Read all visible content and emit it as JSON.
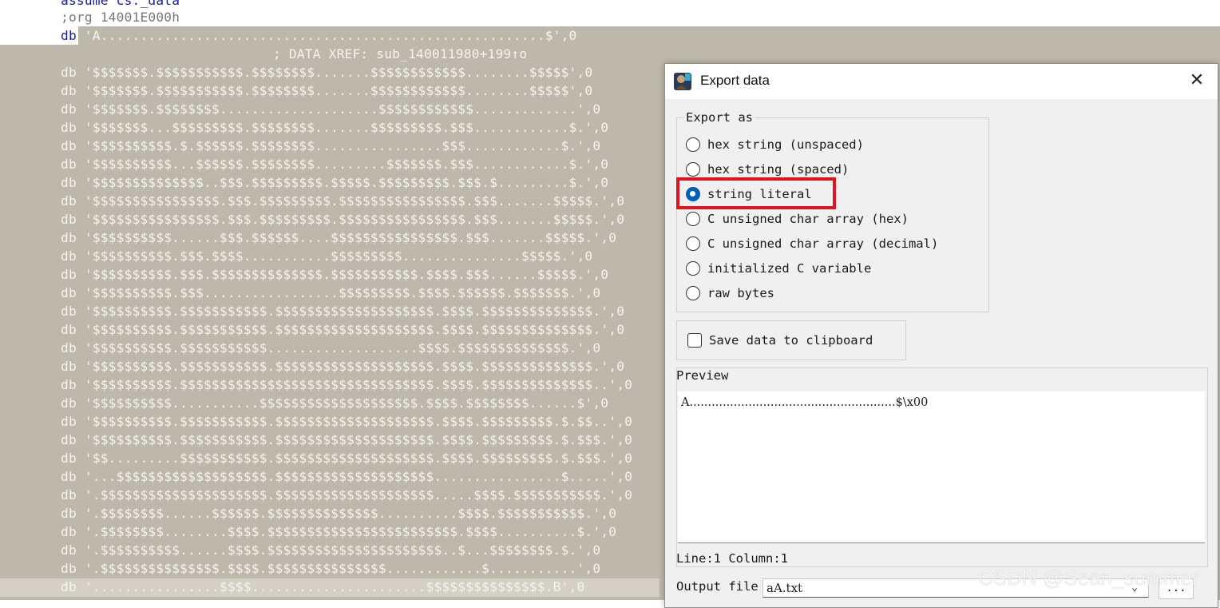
{
  "listing": {
    "header_lines": [
      "assume cs:_data",
      ";org 14001E000h"
    ],
    "first_db_keyword": "db",
    "first_db_value": " 'A........................................................$',0",
    "xref_comment": "; DATA XREF: sub_140011980+199↑o",
    "rows": [
      "db '$$$$$$$.$$$$$$$$$$$.$$$$$$$$.......$$$$$$$$$$$$........$$$$$',0",
      "db '$$$$$$$.$$$$$$$$$$$.$$$$$$$$.......$$$$$$$$$$$$........$$$$$',0",
      "db '$$$$$$$.$$$$$$$$....................$$$$$$$$$$$$.............',0",
      "db '$$$$$$$...$$$$$$$$$.$$$$$$$$.......$$$$$$$$$.$$$............$.',0",
      "db '$$$$$$$$$$.$.$$$$$$.$$$$$$$$................$$$............$.',0",
      "db '$$$$$$$$$$...$$$$$$.$$$$$$$$.........$$$$$$$.$$$............$.',0",
      "db '$$$$$$$$$$$$$$..$$$.$$$$$$$$$.$$$$$.$$$$$$$$$.$$$.$.........$.',0",
      "db '$$$$$$$$$$$$$$$$.$$$.$$$$$$$$$.$$$$$$$$$$$$$$$$.$$$.......$$$$$.',0",
      "db '$$$$$$$$$$$$$$$$.$$$.$$$$$$$$$.$$$$$$$$$$$$$$$$.$$$.......$$$$$.',0",
      "db '$$$$$$$$$$......$$$.$$$$$$....$$$$$$$$$$$$$$$$.$$$.......$$$$$.',0",
      "db '$$$$$$$$$$.$$$.$$$$...........$$$$$$$$$...............$$$$$.',0",
      "db '$$$$$$$$$$.$$$.$$$$$$$$$$$$$$.$$$$$$$$$$$.$$$$.$$$......$$$$$.',0",
      "db '$$$$$$$$$$.$$$.................$$$$$$$$$.$$$$.$$$$$$.$$$$$$$.',0",
      "db '$$$$$$$$$$.$$$$$$$$$$$.$$$$$$$$$$$$$$$$$$$$.$$$$.$$$$$$$$$$$$$$.',0",
      "db '$$$$$$$$$$.$$$$$$$$$$$.$$$$$$$$$$$$$$$$$$$$.$$$$.$$$$$$$$$$$$$$.',0",
      "db '$$$$$$$$$$.$$$$$$$$$$$...................$$$$.$$$$$$$$$$$$$$.',0",
      "db '$$$$$$$$$$.$$$$$$$$$$$.$$$$$$$$$$$$$$$$$$$$.$$$$.$$$$$$$$$$$$$$.',0",
      "db '$$$$$$$$$$.$$$$$$$$$$$$$$$$$$$$$$$$$$$$$$$$.$$$$.$$$$$$$$$$$$$$..',0",
      "db '$$$$$$$$$$...........$$$$$$$$$$$$$$$$$$$$.$$$$.$$$$$$$$......$',0",
      "db '$$$$$$$$$$.$$$$$$$$$$$.$$$$$$$$$$$$$$$$$$$$.$$$$.$$$$$$$$$.$.$$..',0",
      "db '$$$$$$$$$$.$$$$$$$$$$$.$$$$$$$$$$$$$$$$$$$$.$$$$.$$$$$$$$$.$.$$$.',0",
      "db '$$.........$$$$$$$$$$$.$$$$$$$$$$$$$$$$$$$$.$$$$.$$$$$$$$$.$.$$$.',0",
      "db '...$$$$$$$$$$$$$$$$$$$.$$$$$$$$$$$$$$$$$$$$................$.....',0",
      "db '.$$$$$$$$$$$$$$$$$$$$$.$$$$$$$$$$$$$$$$$$$$.....$$$$.$$$$$$$$$$$.',0",
      "db '.$$$$$$$$......$$$$$$.$$$$$$$$$$$$$$..........$$$$.$$$$$$$$$$$.',0",
      "db '.$$$$$$$$........$$$$.$$$$$$$$$$$$$$$$$$$$$$$$.$$$$..........$.',0",
      "db '.$$$$$$$$$$......$$$$.$$$$$$$$$$$$$$$$$$$$$$..$...$$$$$$$$.$.',0",
      "db '.$$$$$$$$$$$$$$$.$$$$.$$$$$$$$$$$$$$$............$...........',0",
      "db '................$$$$......................$$$$$$$$$$$$$$$.B',0"
    ]
  },
  "dialog": {
    "title": "Export data",
    "export_as_label": "Export as",
    "options": [
      {
        "label": "hex string (unspaced)",
        "checked": false
      },
      {
        "label": "hex string (spaced)",
        "checked": false
      },
      {
        "label": "string literal",
        "checked": true
      },
      {
        "label": "C unsigned char array (hex)",
        "checked": false
      },
      {
        "label": "C unsigned char array (decimal)",
        "checked": false
      },
      {
        "label": "initialized C variable",
        "checked": false
      },
      {
        "label": "raw bytes",
        "checked": false
      }
    ],
    "save_clipboard_label": "Save data to clipboard",
    "preview_label": "Preview",
    "preview_text": "A........................................................$\\x00",
    "status": "Line:1  Column:1",
    "output_file_label": "Output file",
    "output_file_value": "aA.txt",
    "browse_label": "...",
    "highlight_color": "#e0141e"
  },
  "watermark": "CSDN @Sean_summer"
}
